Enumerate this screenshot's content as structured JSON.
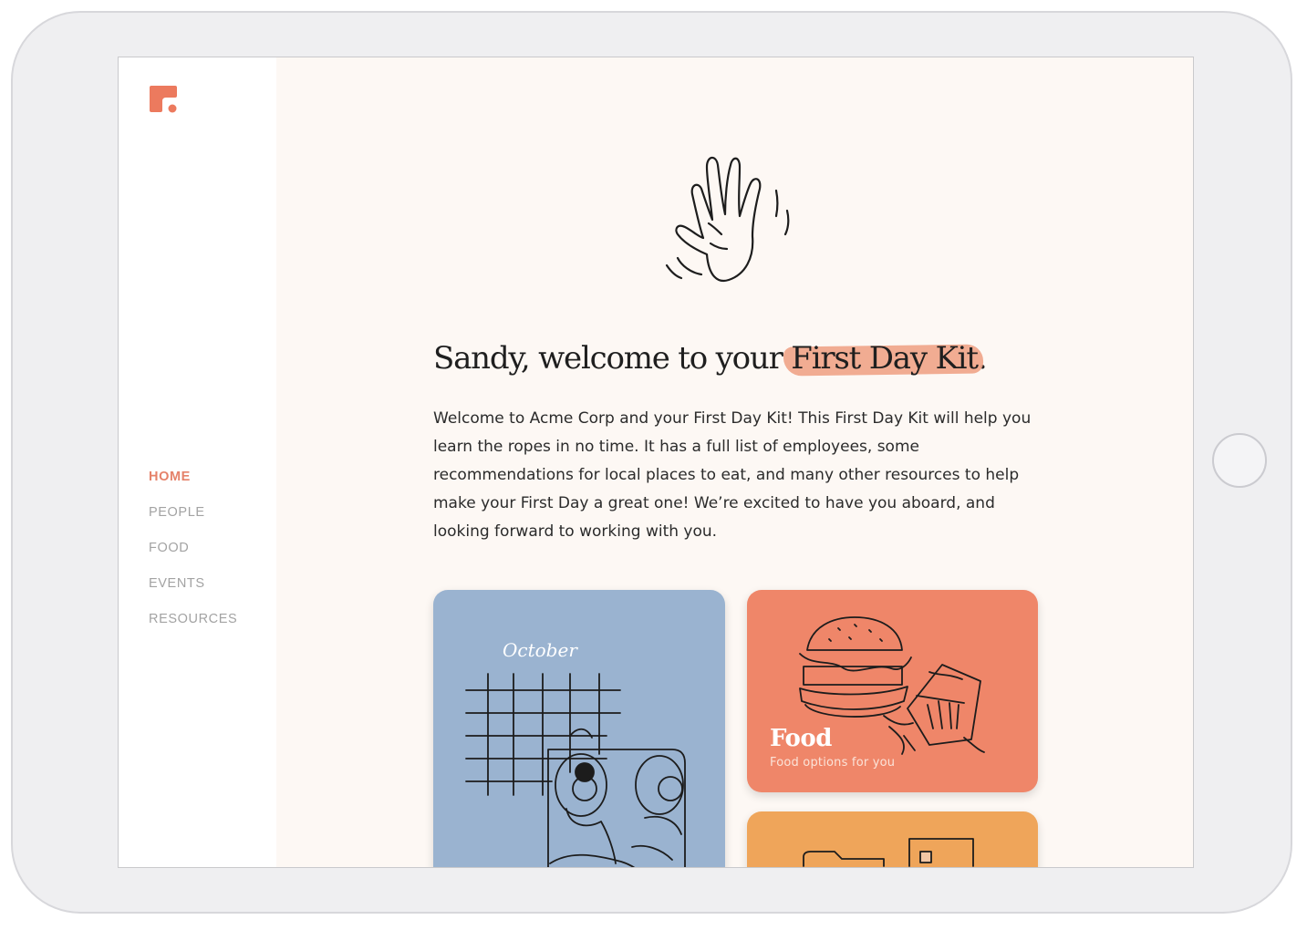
{
  "app": {
    "brand_color": "#ec7a5e",
    "logo_icon": "firstday-logo-icon"
  },
  "nav": {
    "items": [
      {
        "label": "HOME",
        "active": true
      },
      {
        "label": "PEOPLE",
        "active": false
      },
      {
        "label": "FOOD",
        "active": false
      },
      {
        "label": "EVENTS",
        "active": false
      },
      {
        "label": "RESOURCES",
        "active": false
      }
    ],
    "active_color": "#e5826a"
  },
  "hero": {
    "icon": "waving-hand-icon",
    "headline_prefix": "Sandy, welcome to your ",
    "headline_highlight": "First Day Kit",
    "headline_suffix": ".",
    "highlight_color": "#f0a387",
    "intro": "Welcome to Acme Corp and your First Day Kit! This First Day Kit will help you learn the ropes in no time. It has a full list of employees, some recommendations for local places to eat, and many other resources to help make your First Day a great one! We’re excited to have you aboard, and looking forward to working with you."
  },
  "cards": {
    "events": {
      "illustration": "calendar-bed-illustration",
      "script_word": "October",
      "color": "#9ab3d0"
    },
    "food": {
      "title": "Food",
      "subtitle": "Food options for you",
      "illustration": "burger-fries-illustration",
      "color": "#ef8669"
    },
    "resources": {
      "illustration": "folder-document-illustration",
      "color": "#efa55a"
    }
  }
}
